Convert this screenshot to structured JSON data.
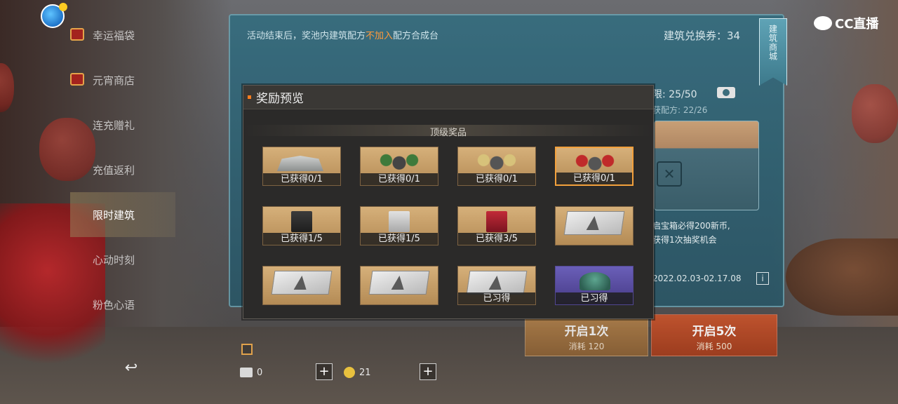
{
  "watermark": {
    "brand": "CC直播"
  },
  "side_menu": {
    "items": [
      {
        "label": "幸运福袋",
        "active": false,
        "icon": "gift-icon"
      },
      {
        "label": "元宵商店",
        "active": false,
        "icon": "gift-icon"
      },
      {
        "label": "连充赠礼",
        "active": false
      },
      {
        "label": "充值返利",
        "active": false
      },
      {
        "label": "限时建筑",
        "active": true
      },
      {
        "label": "心动时刻",
        "active": false
      },
      {
        "label": "粉色心语",
        "active": false
      }
    ],
    "back_icon": "back-arrow-icon"
  },
  "main": {
    "notice_prefix": "活动结束后，奖池内建筑配方",
    "notice_highlight": "不加入",
    "notice_suffix": "配方合成台",
    "voucher": "建筑兑换券：34",
    "shop_tag": "建筑商城",
    "limit": "限: 25/50",
    "recipe": "获配方: 22/26",
    "chest_icon": "tools-icon",
    "desc_line1": "启宝箱必得200新币,",
    "desc_line2": "获得1次抽奖机会",
    "date_range": "2022.02.03-02.17.08",
    "info_label": "i",
    "open_once": {
      "title": "开启1次",
      "cost": "消耗 120"
    },
    "open_five": {
      "title": "开启5次",
      "cost": "消耗 500"
    }
  },
  "bottom_bar": {
    "voucher_count": "0",
    "coin_count": "21",
    "plus": "+"
  },
  "dialog": {
    "title": "奖励预览",
    "section": "顶级奖品",
    "items": [
      {
        "art": "tent",
        "label": "已获得0/1"
      },
      {
        "art": "claw-green",
        "label": "已获得0/1"
      },
      {
        "art": "claw-gold",
        "label": "已获得0/1"
      },
      {
        "art": "claw-red",
        "label": "已获得0/1",
        "selected": true
      },
      {
        "art": "box-dark",
        "label": "已获得1/5"
      },
      {
        "art": "box-silver",
        "label": "已获得1/5"
      },
      {
        "art": "box-red",
        "label": "已获得3/5"
      },
      {
        "art": "blueprint",
        "label": ""
      },
      {
        "art": "blueprint",
        "label": ""
      },
      {
        "art": "blueprint",
        "label": ""
      },
      {
        "art": "blueprint",
        "label": "已习得"
      },
      {
        "art": "dome-purple",
        "label": "已习得"
      }
    ]
  }
}
